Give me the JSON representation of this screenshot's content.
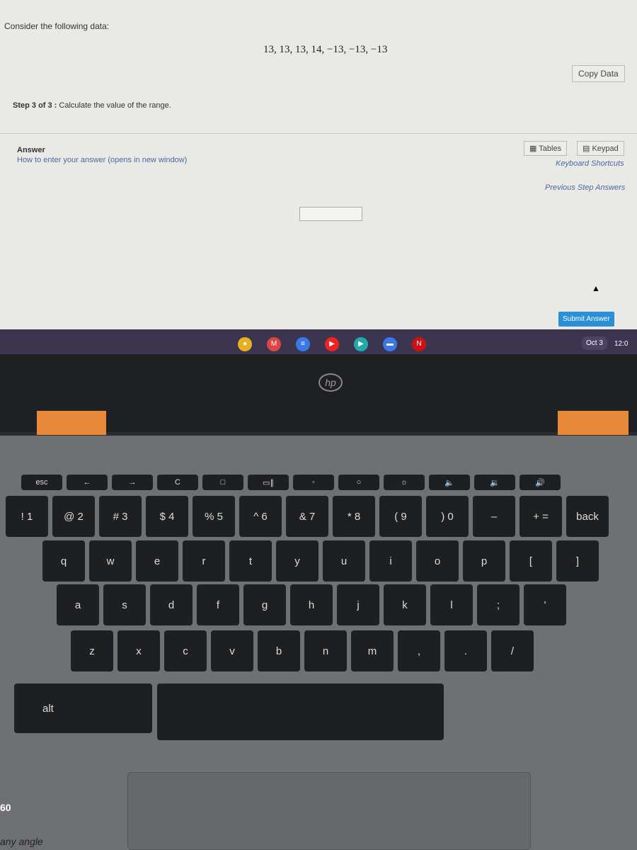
{
  "question": {
    "intro": "Consider the following data:",
    "dataset": "13, 13, 13, 14, −13, −13, −13",
    "copy_data_label": "Copy Data",
    "step_label": "Step 3 of 3 :",
    "step_text": "Calculate the value of the range."
  },
  "answer": {
    "heading": "Answer",
    "howto_link": "How to enter your answer (opens in new window)",
    "input_value": "",
    "tables_label": "Tables",
    "keypad_label": "Keypad",
    "keyboard_shortcuts_link": "Keyboard Shortcuts",
    "previous_step_link": "Previous Step Answers",
    "submit_label": "Submit Answer"
  },
  "shelf": {
    "apps": [
      {
        "name": "chrome-icon",
        "color": "#e8b020",
        "glyph": "●"
      },
      {
        "name": "gmail-icon",
        "color": "#d44",
        "glyph": "M"
      },
      {
        "name": "docs-icon",
        "color": "#3b78e7",
        "glyph": "≡"
      },
      {
        "name": "youtube-icon",
        "color": "#e22",
        "glyph": "▶"
      },
      {
        "name": "play-store-icon",
        "color": "#2aa",
        "glyph": "▶"
      },
      {
        "name": "messages-icon",
        "color": "#3b78e7",
        "glyph": "▬"
      },
      {
        "name": "netflix-icon",
        "color": "#c11",
        "glyph": "N"
      }
    ],
    "date": "Oct 3",
    "time": "12:0"
  },
  "keyboard": {
    "function_row": [
      "esc",
      "←",
      "→",
      "C",
      "□",
      "▭∥",
      "◦",
      "○",
      "☼",
      "🔈",
      "🔉",
      "🔊"
    ],
    "number_row": [
      "! 1",
      "@ 2",
      "# 3",
      "$ 4",
      "% 5",
      "^ 6",
      "& 7",
      "* 8",
      "( 9",
      ") 0",
      "–",
      "+ =",
      "back"
    ],
    "top_row": [
      "q",
      "w",
      "e",
      "r",
      "t",
      "y",
      "u",
      "i",
      "o",
      "p",
      "[",
      "]"
    ],
    "home_row": [
      "a",
      "s",
      "d",
      "f",
      "g",
      "h",
      "j",
      "k",
      "l",
      ";",
      "'"
    ],
    "bottom_row": [
      "z",
      "x",
      "c",
      "v",
      "b",
      "n",
      "m",
      ",",
      ".",
      "/"
    ],
    "alt_label": "alt"
  },
  "stickers": {
    "number": "60",
    "text": "any angle"
  },
  "logo": "hp"
}
